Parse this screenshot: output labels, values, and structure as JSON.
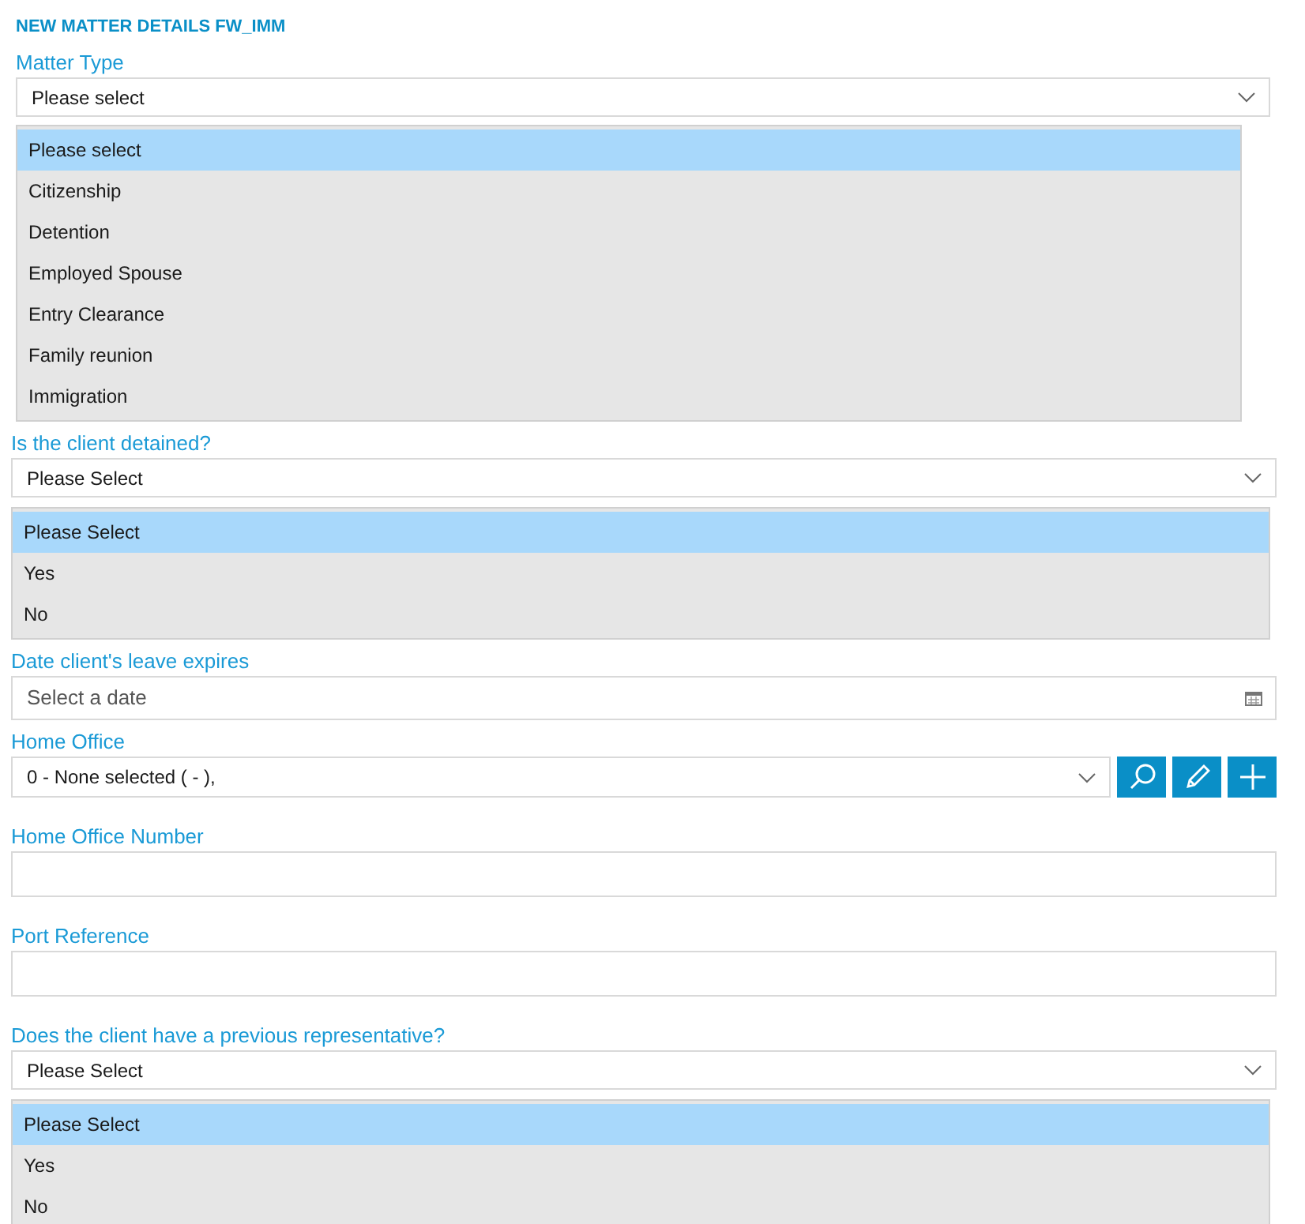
{
  "title": "NEW MATTER DETAILS FW_IMM",
  "fields": [
    {
      "kind": "select",
      "label": "Matter Type",
      "value": "Please select",
      "expanded": true,
      "options": [
        {
          "label": "Please select",
          "selected": true
        },
        {
          "label": "Citizenship",
          "selected": false
        },
        {
          "label": "Detention",
          "selected": false
        },
        {
          "label": "Employed Spouse",
          "selected": false
        },
        {
          "label": "Entry Clearance",
          "selected": false
        },
        {
          "label": "Family reunion",
          "selected": false
        },
        {
          "label": "Immigration",
          "selected": false
        }
      ]
    },
    {
      "kind": "select",
      "label": "Is the client detained?",
      "value": "Please Select",
      "expanded": true,
      "options": [
        {
          "label": "Please Select",
          "selected": true
        },
        {
          "label": "Yes",
          "selected": false
        },
        {
          "label": "No",
          "selected": false
        }
      ]
    },
    {
      "kind": "date",
      "label": "Date client's leave expires",
      "placeholder": "Select a date"
    },
    {
      "kind": "lookup",
      "label": "Home Office",
      "value": "0 -  None selected ( - ),"
    },
    {
      "kind": "text",
      "label": "Home Office Number"
    },
    {
      "kind": "text",
      "label": "Port Reference"
    },
    {
      "kind": "select",
      "label": "Does the client have a previous representative?",
      "value": "Please Select",
      "expanded": true,
      "options": [
        {
          "label": "Please Select",
          "selected": true
        },
        {
          "label": "Yes",
          "selected": false
        },
        {
          "label": "No",
          "selected": false
        }
      ]
    }
  ]
}
